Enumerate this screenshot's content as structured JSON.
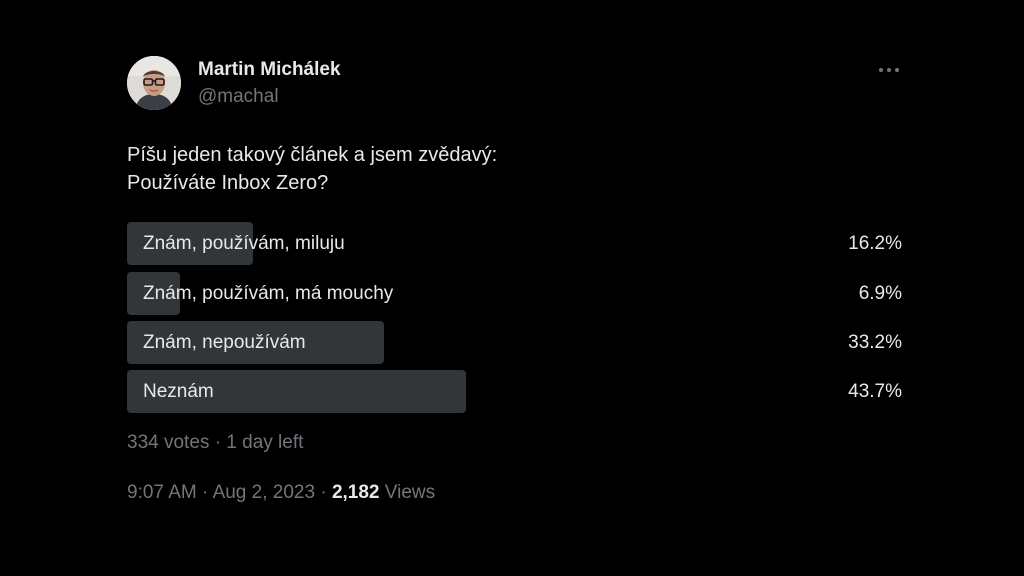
{
  "author": {
    "name": "Martin Michálek",
    "handle": "@machal"
  },
  "tweet": {
    "line1": "Píšu jeden takový článek a jsem zvědavý:",
    "line2": "Používáte Inbox Zero?"
  },
  "poll": {
    "options": [
      {
        "label": "Znám, používám, miluju",
        "percent": "16.2%",
        "share": 0.162
      },
      {
        "label": "Znám, používám, má mouchy",
        "percent": "6.9%",
        "share": 0.069
      },
      {
        "label": "Znám, nepoužívám",
        "percent": "33.2%",
        "share": 0.332
      },
      {
        "label": "Neznám",
        "percent": "43.7%",
        "share": 0.437
      }
    ],
    "votes": "334 votes",
    "separator": "·",
    "time_left": "1 day left"
  },
  "meta": {
    "time": "9:07 AM",
    "separator": "·",
    "date": "Aug 2, 2023",
    "views_count": "2,182",
    "views_label": "Views"
  },
  "colors": {
    "background": "#000000",
    "text": "#e7e9ea",
    "muted": "#71767b",
    "poll_bar": "#333639"
  },
  "icons": {
    "more": "more-dots-icon",
    "avatar": "profile-photo"
  }
}
